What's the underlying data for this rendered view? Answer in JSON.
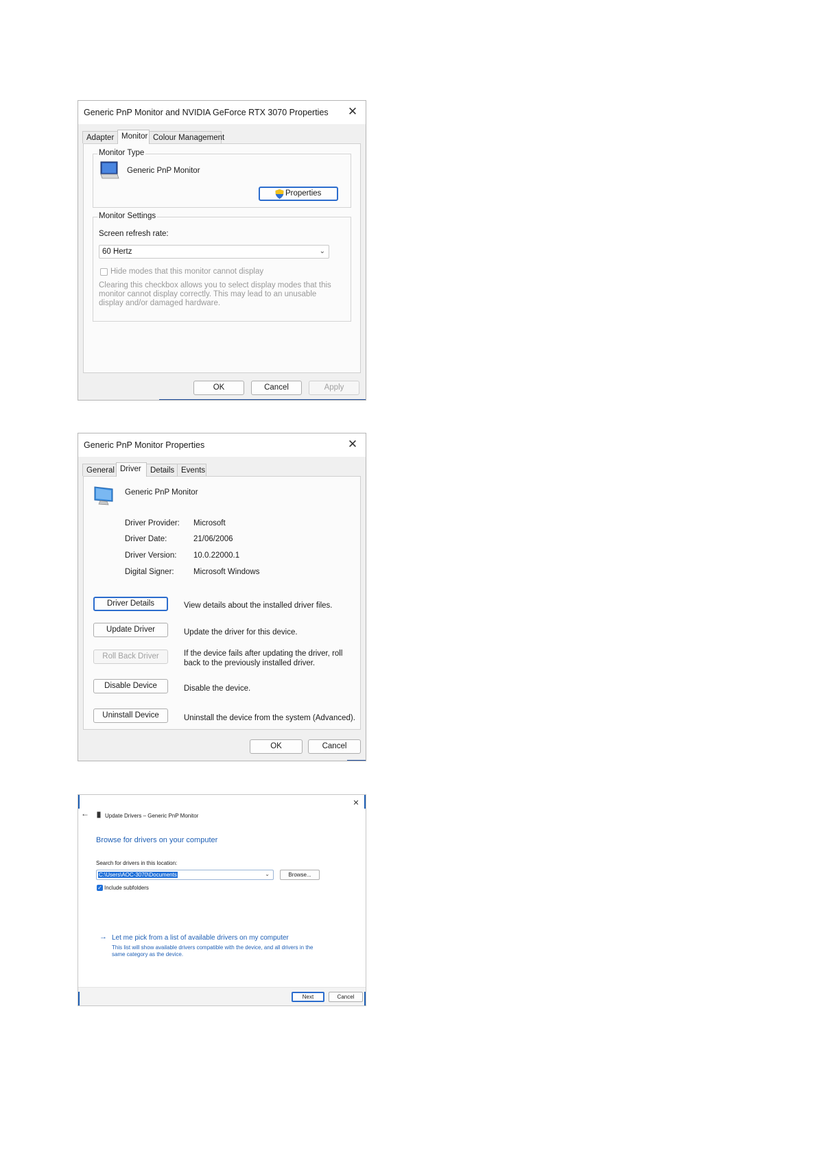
{
  "dialog1": {
    "title": "Generic PnP Monitor and NVIDIA GeForce RTX 3070 Properties",
    "tabs": [
      "Adapter",
      "Monitor",
      "Colour Management"
    ],
    "active_tab": "Monitor",
    "monitor_type": {
      "legend": "Monitor Type",
      "name": "Generic PnP Monitor",
      "properties_button": "Properties"
    },
    "monitor_settings": {
      "legend": "Monitor Settings",
      "refresh_label": "Screen refresh rate:",
      "refresh_value": "60 Hertz",
      "hide_modes_label": "Hide modes that this monitor cannot display",
      "hide_modes_desc": [
        "Clearing this checkbox allows you to select display modes that this",
        "monitor cannot display correctly. This may lead to an unusable",
        "display and/or damaged hardware."
      ]
    },
    "buttons": {
      "ok": "OK",
      "cancel": "Cancel",
      "apply": "Apply"
    }
  },
  "dialog2": {
    "title": "Generic PnP Monitor Properties",
    "tabs": [
      "General",
      "Driver",
      "Details",
      "Events"
    ],
    "active_tab": "Driver",
    "device_name": "Generic PnP Monitor",
    "info": [
      {
        "label": "Driver Provider:",
        "value": "Microsoft"
      },
      {
        "label": "Driver Date:",
        "value": "21/06/2006"
      },
      {
        "label": "Driver Version:",
        "value": "10.0.22000.1"
      },
      {
        "label": "Digital Signer:",
        "value": "Microsoft Windows"
      }
    ],
    "actions": [
      {
        "button": "Driver Details",
        "desc": [
          "View details about the installed driver files."
        ]
      },
      {
        "button": "Update Driver",
        "desc": [
          "Update the driver for this device."
        ]
      },
      {
        "button": "Roll Back Driver",
        "desc": [
          "If the device fails after updating the driver, roll",
          "back to the previously installed driver."
        ]
      },
      {
        "button": "Disable Device",
        "desc": [
          "Disable the device."
        ]
      },
      {
        "button": "Uninstall Device",
        "desc": [
          "Uninstall the device from the system (Advanced)."
        ]
      }
    ],
    "buttons": {
      "ok": "OK",
      "cancel": "Cancel"
    }
  },
  "dialog3": {
    "header": "Update Drivers – Generic PnP Monitor",
    "heading": "Browse for drivers on your computer",
    "search_label": "Search for drivers in this location:",
    "path_value": "C:\\Users\\AOC-3070\\Documents",
    "browse_button": "Browse...",
    "include_subfolders": "Include subfolders",
    "pick_link": "Let me pick from a list of available drivers on my computer",
    "pick_desc": [
      "This list will show available drivers compatible with the device, and all drivers in the",
      "same category as the device."
    ],
    "buttons": {
      "next": "Next",
      "cancel": "Cancel"
    }
  },
  "icons": {
    "close": "✕",
    "back": "←",
    "arrow_right": "→",
    "chevron_down": "⌄"
  }
}
